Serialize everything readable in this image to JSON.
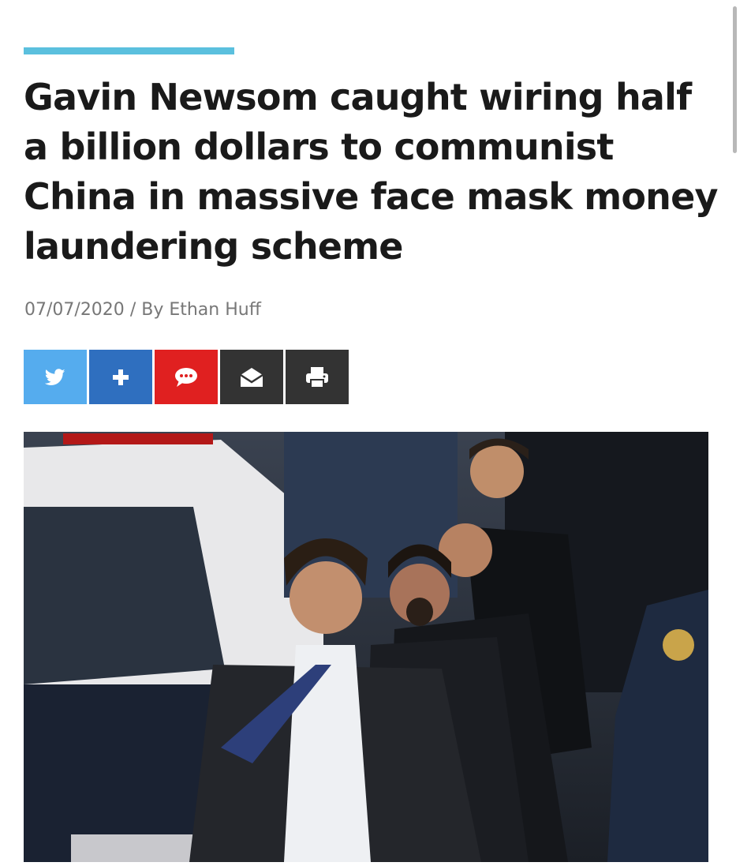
{
  "article": {
    "headline": "Gavin Newsom caught wiring half a billion dollars to communist China in massive face mask money laundering scheme",
    "date": "07/07/2020",
    "separator": "/",
    "byline": "By Ethan Huff",
    "accent_color": "#5bc0de"
  },
  "share_buttons": [
    {
      "icon": "twitter-icon",
      "color": "#55acee"
    },
    {
      "icon": "plus-icon",
      "color": "#2f6fbf"
    },
    {
      "icon": "comment-icon",
      "color": "#e02020"
    },
    {
      "icon": "email-icon",
      "color": "#333333"
    },
    {
      "icon": "print-icon",
      "color": "#333333"
    }
  ],
  "hero_image": {
    "subject": "news-photo"
  }
}
